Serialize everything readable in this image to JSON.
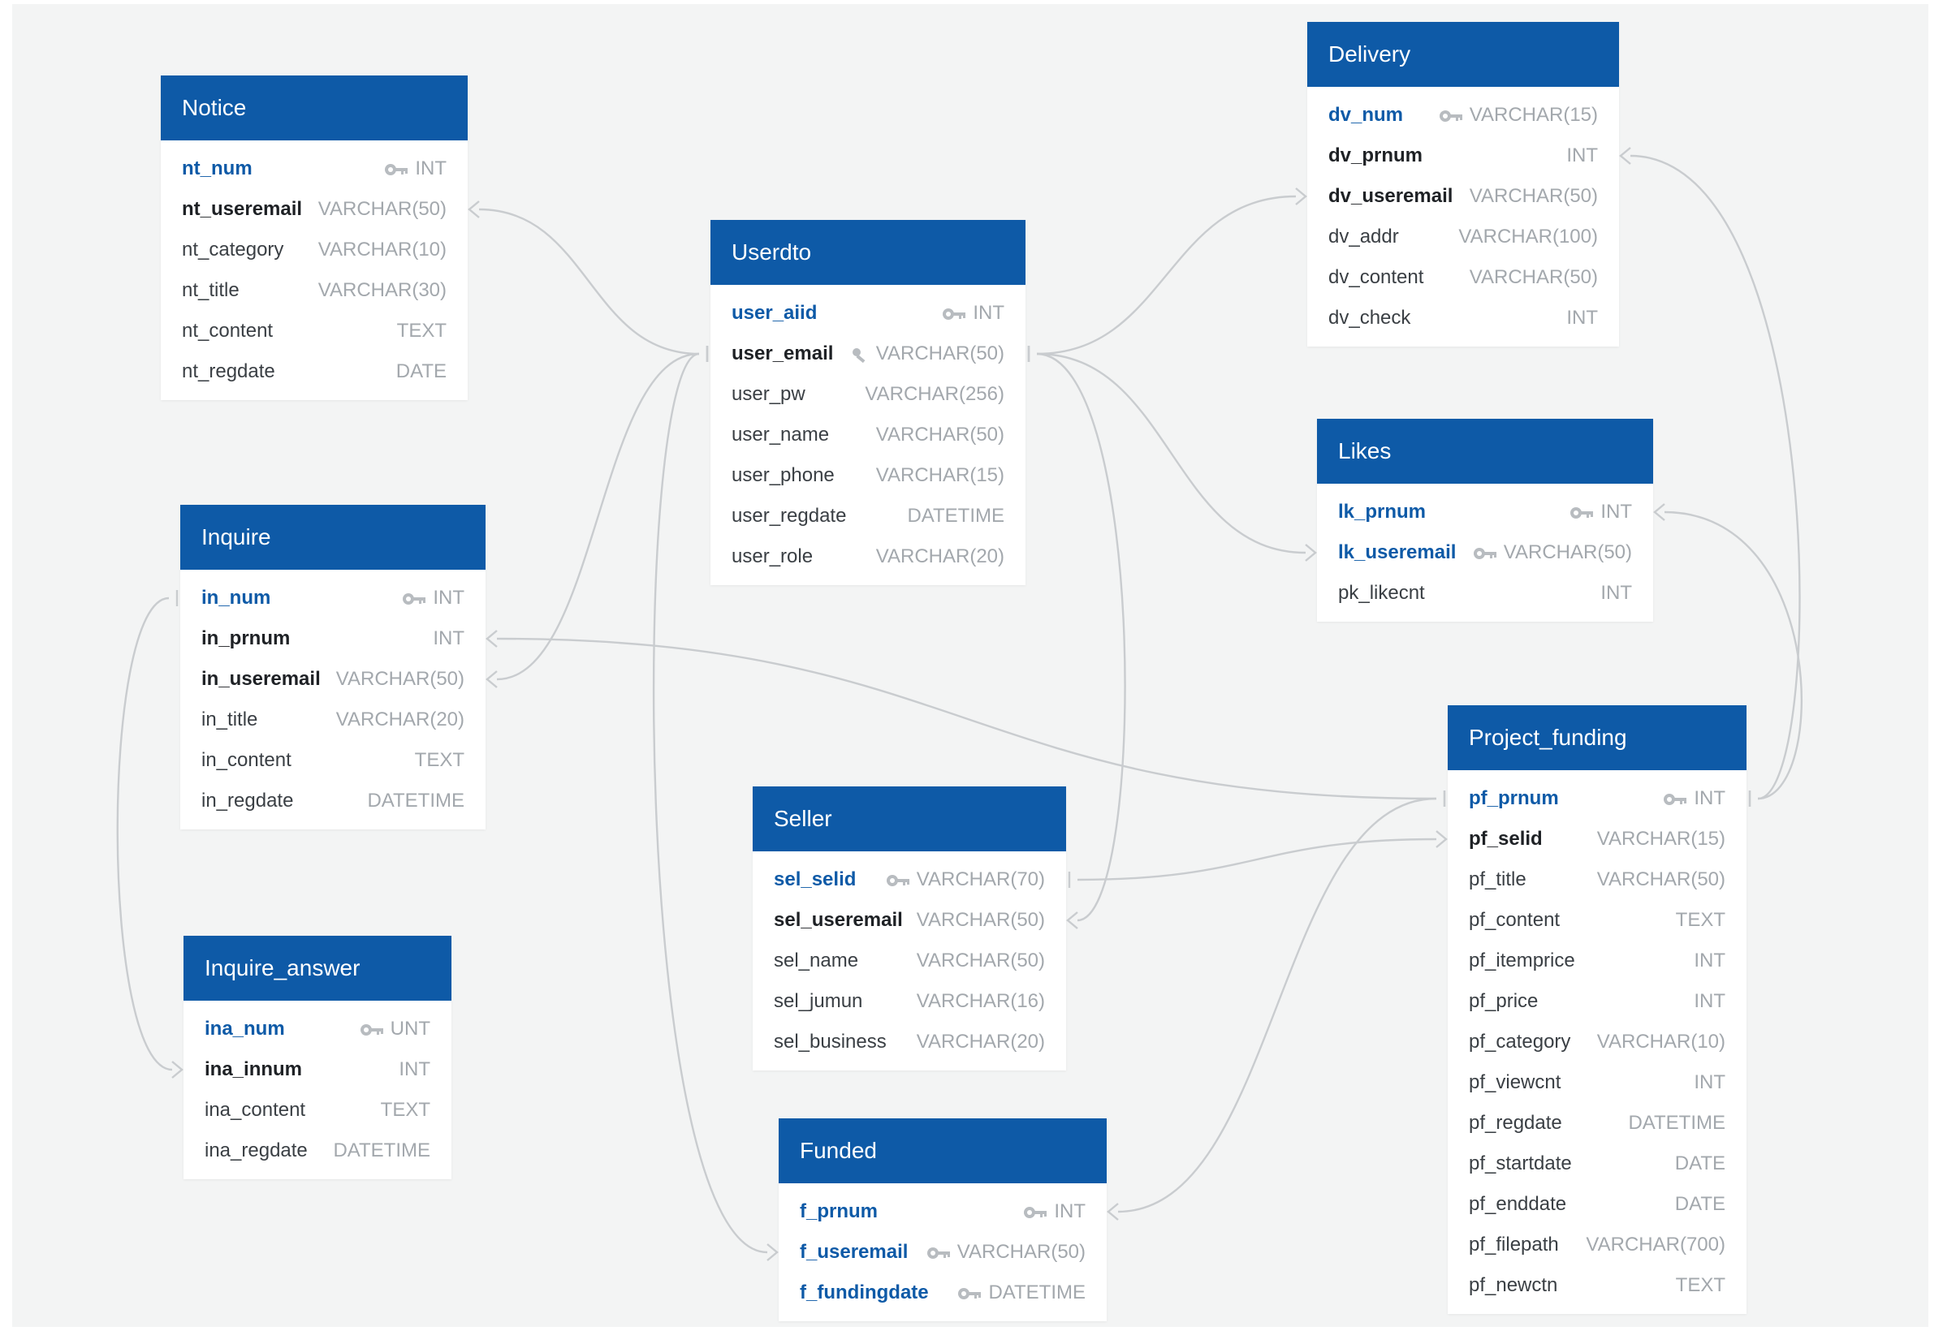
{
  "diagram": {
    "tables": [
      {
        "id": "notice",
        "name": "Notice",
        "columns": [
          {
            "name": "nt_num",
            "type": "INT",
            "kind": "pk",
            "icon": "key-icon"
          },
          {
            "name": "nt_useremail",
            "type": "VARCHAR(50)",
            "kind": "fk",
            "icon": ""
          },
          {
            "name": "nt_category",
            "type": "VARCHAR(10)",
            "kind": "",
            "icon": ""
          },
          {
            "name": "nt_title",
            "type": "VARCHAR(30)",
            "kind": "",
            "icon": ""
          },
          {
            "name": "nt_content",
            "type": "TEXT",
            "kind": "",
            "icon": ""
          },
          {
            "name": "nt_regdate",
            "type": "DATE",
            "kind": "",
            "icon": ""
          }
        ]
      },
      {
        "id": "userdto",
        "name": "Userdto",
        "columns": [
          {
            "name": "user_aiid",
            "type": "INT",
            "kind": "pk",
            "icon": "key-icon"
          },
          {
            "name": "user_email",
            "type": "VARCHAR(50)",
            "kind": "fk",
            "icon": "unique-key-icon"
          },
          {
            "name": "user_pw",
            "type": "VARCHAR(256)",
            "kind": "",
            "icon": ""
          },
          {
            "name": "user_name",
            "type": "VARCHAR(50)",
            "kind": "",
            "icon": ""
          },
          {
            "name": "user_phone",
            "type": "VARCHAR(15)",
            "kind": "",
            "icon": ""
          },
          {
            "name": "user_regdate",
            "type": "DATETIME",
            "kind": "",
            "icon": ""
          },
          {
            "name": "user_role",
            "type": "VARCHAR(20)",
            "kind": "",
            "icon": ""
          }
        ]
      },
      {
        "id": "delivery",
        "name": "Delivery",
        "columns": [
          {
            "name": "dv_num",
            "type": "VARCHAR(15)",
            "kind": "pk",
            "icon": "key-icon"
          },
          {
            "name": "dv_prnum",
            "type": "INT",
            "kind": "fk",
            "icon": ""
          },
          {
            "name": "dv_useremail",
            "type": "VARCHAR(50)",
            "kind": "fk",
            "icon": ""
          },
          {
            "name": "dv_addr",
            "type": "VARCHAR(100)",
            "kind": "",
            "icon": ""
          },
          {
            "name": "dv_content",
            "type": "VARCHAR(50)",
            "kind": "",
            "icon": ""
          },
          {
            "name": "dv_check",
            "type": "INT",
            "kind": "",
            "icon": ""
          }
        ]
      },
      {
        "id": "likes",
        "name": "Likes",
        "columns": [
          {
            "name": "lk_prnum",
            "type": "INT",
            "kind": "pk",
            "icon": "key-icon"
          },
          {
            "name": "lk_useremail",
            "type": "VARCHAR(50)",
            "kind": "pk",
            "icon": "key-icon"
          },
          {
            "name": "pk_likecnt",
            "type": "INT",
            "kind": "",
            "icon": ""
          }
        ]
      },
      {
        "id": "inquire",
        "name": "Inquire",
        "columns": [
          {
            "name": "in_num",
            "type": "INT",
            "kind": "pk",
            "icon": "key-icon"
          },
          {
            "name": "in_prnum",
            "type": "INT",
            "kind": "fk",
            "icon": ""
          },
          {
            "name": "in_useremail",
            "type": "VARCHAR(50)",
            "kind": "fk",
            "icon": ""
          },
          {
            "name": "in_title",
            "type": "VARCHAR(20)",
            "kind": "",
            "icon": ""
          },
          {
            "name": "in_content",
            "type": "TEXT",
            "kind": "",
            "icon": ""
          },
          {
            "name": "in_regdate",
            "type": "DATETIME",
            "kind": "",
            "icon": ""
          }
        ]
      },
      {
        "id": "project_funding",
        "name": "Project_funding",
        "columns": [
          {
            "name": "pf_prnum",
            "type": "INT",
            "kind": "pk",
            "icon": "key-icon"
          },
          {
            "name": "pf_selid",
            "type": "VARCHAR(15)",
            "kind": "fk",
            "icon": ""
          },
          {
            "name": "pf_title",
            "type": "VARCHAR(50)",
            "kind": "",
            "icon": ""
          },
          {
            "name": "pf_content",
            "type": "TEXT",
            "kind": "",
            "icon": ""
          },
          {
            "name": "pf_itemprice",
            "type": "INT",
            "kind": "",
            "icon": ""
          },
          {
            "name": "pf_price",
            "type": "INT",
            "kind": "",
            "icon": ""
          },
          {
            "name": "pf_category",
            "type": "VARCHAR(10)",
            "kind": "",
            "icon": ""
          },
          {
            "name": "pf_viewcnt",
            "type": "INT",
            "kind": "",
            "icon": ""
          },
          {
            "name": "pf_regdate",
            "type": "DATETIME",
            "kind": "",
            "icon": ""
          },
          {
            "name": "pf_startdate",
            "type": "DATE",
            "kind": "",
            "icon": ""
          },
          {
            "name": "pf_enddate",
            "type": "DATE",
            "kind": "",
            "icon": ""
          },
          {
            "name": "pf_filepath",
            "type": "VARCHAR(700)",
            "kind": "",
            "icon": ""
          },
          {
            "name": "pf_newctn",
            "type": "TEXT",
            "kind": "",
            "icon": ""
          }
        ]
      },
      {
        "id": "seller",
        "name": "Seller",
        "columns": [
          {
            "name": "sel_selid",
            "type": "VARCHAR(70)",
            "kind": "pk",
            "icon": "key-icon"
          },
          {
            "name": "sel_useremail",
            "type": "VARCHAR(50)",
            "kind": "fk",
            "icon": ""
          },
          {
            "name": "sel_name",
            "type": "VARCHAR(50)",
            "kind": "",
            "icon": ""
          },
          {
            "name": "sel_jumun",
            "type": "VARCHAR(16)",
            "kind": "",
            "icon": ""
          },
          {
            "name": "sel_business",
            "type": "VARCHAR(20)",
            "kind": "",
            "icon": ""
          }
        ]
      },
      {
        "id": "inquire_answer",
        "name": "Inquire_answer",
        "columns": [
          {
            "name": "ina_num",
            "type": "UNT",
            "kind": "pk",
            "icon": "key-icon"
          },
          {
            "name": "ina_innum",
            "type": "INT",
            "kind": "fk",
            "icon": ""
          },
          {
            "name": "ina_content",
            "type": "TEXT",
            "kind": "",
            "icon": ""
          },
          {
            "name": "ina_regdate",
            "type": "DATETIME",
            "kind": "",
            "icon": ""
          }
        ]
      },
      {
        "id": "funded",
        "name": "Funded",
        "columns": [
          {
            "name": "f_prnum",
            "type": "INT",
            "kind": "pk",
            "icon": "key-icon"
          },
          {
            "name": "f_useremail",
            "type": "VARCHAR(50)",
            "kind": "pk",
            "icon": "key-icon"
          },
          {
            "name": "f_fundingdate",
            "type": "DATETIME",
            "kind": "pk",
            "icon": "key-icon"
          }
        ]
      }
    ],
    "relationships": [
      {
        "from": "notice.nt_useremail",
        "to": "userdto.user_email",
        "cardinality": "many-to-one"
      },
      {
        "from": "inquire.in_useremail",
        "to": "userdto.user_email",
        "cardinality": "many-to-one"
      },
      {
        "from": "funded.f_useremail",
        "to": "userdto.user_email",
        "cardinality": "many-to-one"
      },
      {
        "from": "delivery.dv_useremail",
        "to": "userdto.user_email",
        "cardinality": "many-to-one"
      },
      {
        "from": "likes.lk_useremail",
        "to": "userdto.user_email",
        "cardinality": "many-to-one"
      },
      {
        "from": "seller.sel_useremail",
        "to": "userdto.user_email",
        "cardinality": "many-to-one"
      },
      {
        "from": "inquire_answer.ina_innum",
        "to": "inquire.in_num",
        "cardinality": "many-to-one"
      },
      {
        "from": "inquire.in_prnum",
        "to": "project_funding.pf_prnum",
        "cardinality": "many-to-one"
      },
      {
        "from": "delivery.dv_prnum",
        "to": "project_funding.pf_prnum",
        "cardinality": "many-to-one"
      },
      {
        "from": "likes.lk_prnum",
        "to": "project_funding.pf_prnum",
        "cardinality": "many-to-one"
      },
      {
        "from": "funded.f_prnum",
        "to": "project_funding.pf_prnum",
        "cardinality": "many-to-one"
      },
      {
        "from": "project_funding.pf_selid",
        "to": "seller.sel_selid",
        "cardinality": "many-to-one"
      }
    ],
    "colors": {
      "header": "#0e5aa7",
      "pk_text": "#0e5aa7",
      "type_text": "#a3a8ad",
      "connector": "#c9cccf",
      "canvas": "#f3f4f4"
    }
  }
}
